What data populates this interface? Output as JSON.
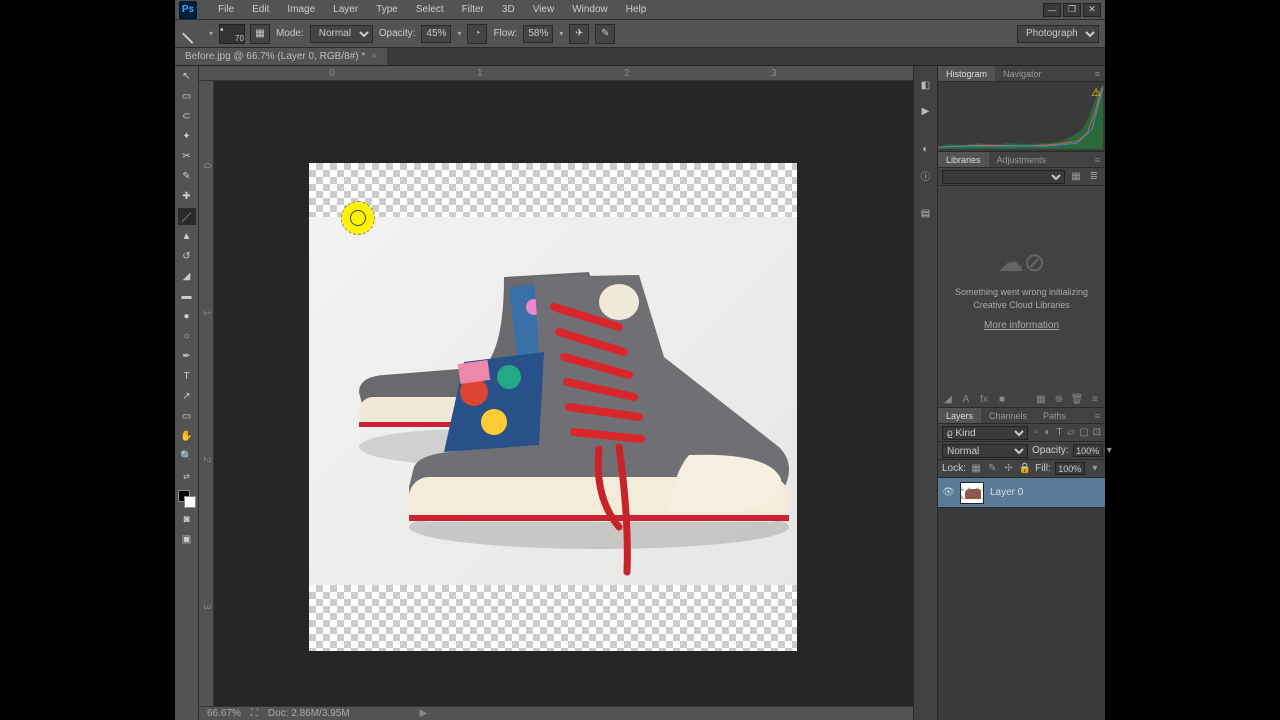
{
  "app": {
    "logo_text": "Ps"
  },
  "menus": [
    "File",
    "Edit",
    "Image",
    "Layer",
    "Type",
    "Select",
    "Filter",
    "3D",
    "View",
    "Window",
    "Help"
  ],
  "window_controls": {
    "min": "—",
    "max": "❐",
    "close": "✕"
  },
  "options_bar": {
    "brush_size": "70",
    "mode_label": "Mode:",
    "mode_value": "Normal",
    "opacity_label": "Opacity:",
    "opacity_value": "45%",
    "flow_label": "Flow:",
    "flow_value": "58%",
    "workspace": "Photography"
  },
  "document": {
    "tab_title": "Before.jpg @ 66.7% (Layer 0, RGB/8#) *"
  },
  "ruler_marks_h": [
    "0",
    "1",
    "2",
    "3"
  ],
  "ruler_marks_v": [
    "0",
    "1",
    "2",
    "3"
  ],
  "statusbar": {
    "zoom": "66.67%",
    "doc": "Doc: 2.86M/3.95M"
  },
  "panels": {
    "histogram_tabs": [
      "Histogram",
      "Navigator"
    ],
    "lib_tabs": [
      "Libraries",
      "Adjustments"
    ],
    "lib_error": "Something went wrong initializing Creative Cloud Libraries",
    "lib_link": "More information",
    "layer_tabs": [
      "Layers",
      "Channels",
      "Paths"
    ],
    "layer_filter": "ϱ Kind",
    "blend_mode": "Normal",
    "opacity_label": "Opacity:",
    "opacity_value": "100%",
    "lock_label": "Lock:",
    "fill_label": "Fill:",
    "fill_value": "100%",
    "layer0_name": "Layer 0"
  },
  "tools": [
    "move",
    "marquee",
    "lasso",
    "wand",
    "crop",
    "eyedrop",
    "heal",
    "brush",
    "stamp",
    "history",
    "eraser",
    "gradient",
    "blur",
    "dodge",
    "pen",
    "type",
    "path",
    "shape",
    "hand",
    "zoom"
  ],
  "dock_icons": [
    "◧",
    "▶",
    "◐",
    "ⓘ",
    "▤"
  ]
}
